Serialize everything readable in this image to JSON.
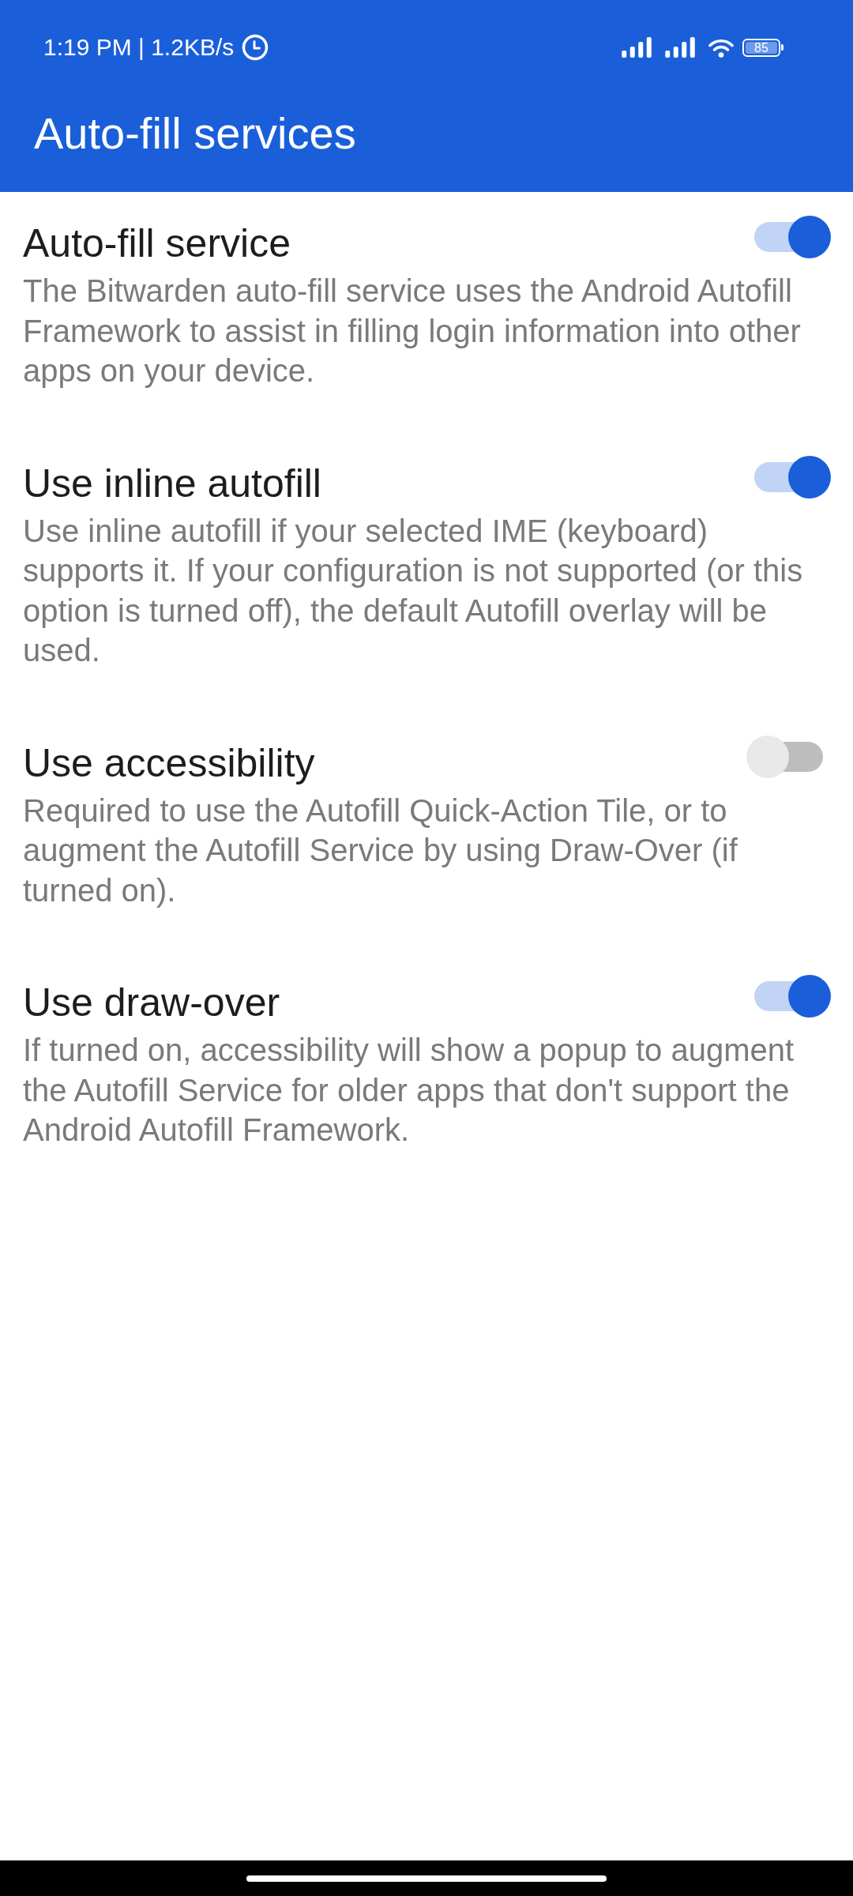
{
  "status_bar": {
    "time_and_speed": "1:19 PM | 1.2KB/s",
    "battery": "85"
  },
  "app_bar": {
    "title": "Auto-fill services"
  },
  "settings": [
    {
      "title": "Auto-fill service",
      "description": "The Bitwarden auto-fill service uses the Android Autofill Framework to assist in filling login information into other apps on your device.",
      "on": true
    },
    {
      "title": "Use inline autofill",
      "description": "Use inline autofill if your selected IME (keyboard) supports it. If your configuration is not supported (or this option is turned off), the default Autofill overlay will be used.",
      "on": true
    },
    {
      "title": "Use accessibility",
      "description": "Required to use the Autofill Quick-Action Tile, or to augment the Autofill Service by using Draw-Over (if turned on).",
      "on": false
    },
    {
      "title": "Use draw-over",
      "description": "If turned on, accessibility will show a popup to augment the Autofill Service for older apps that don't support the Android Autofill Framework.",
      "on": true
    }
  ]
}
